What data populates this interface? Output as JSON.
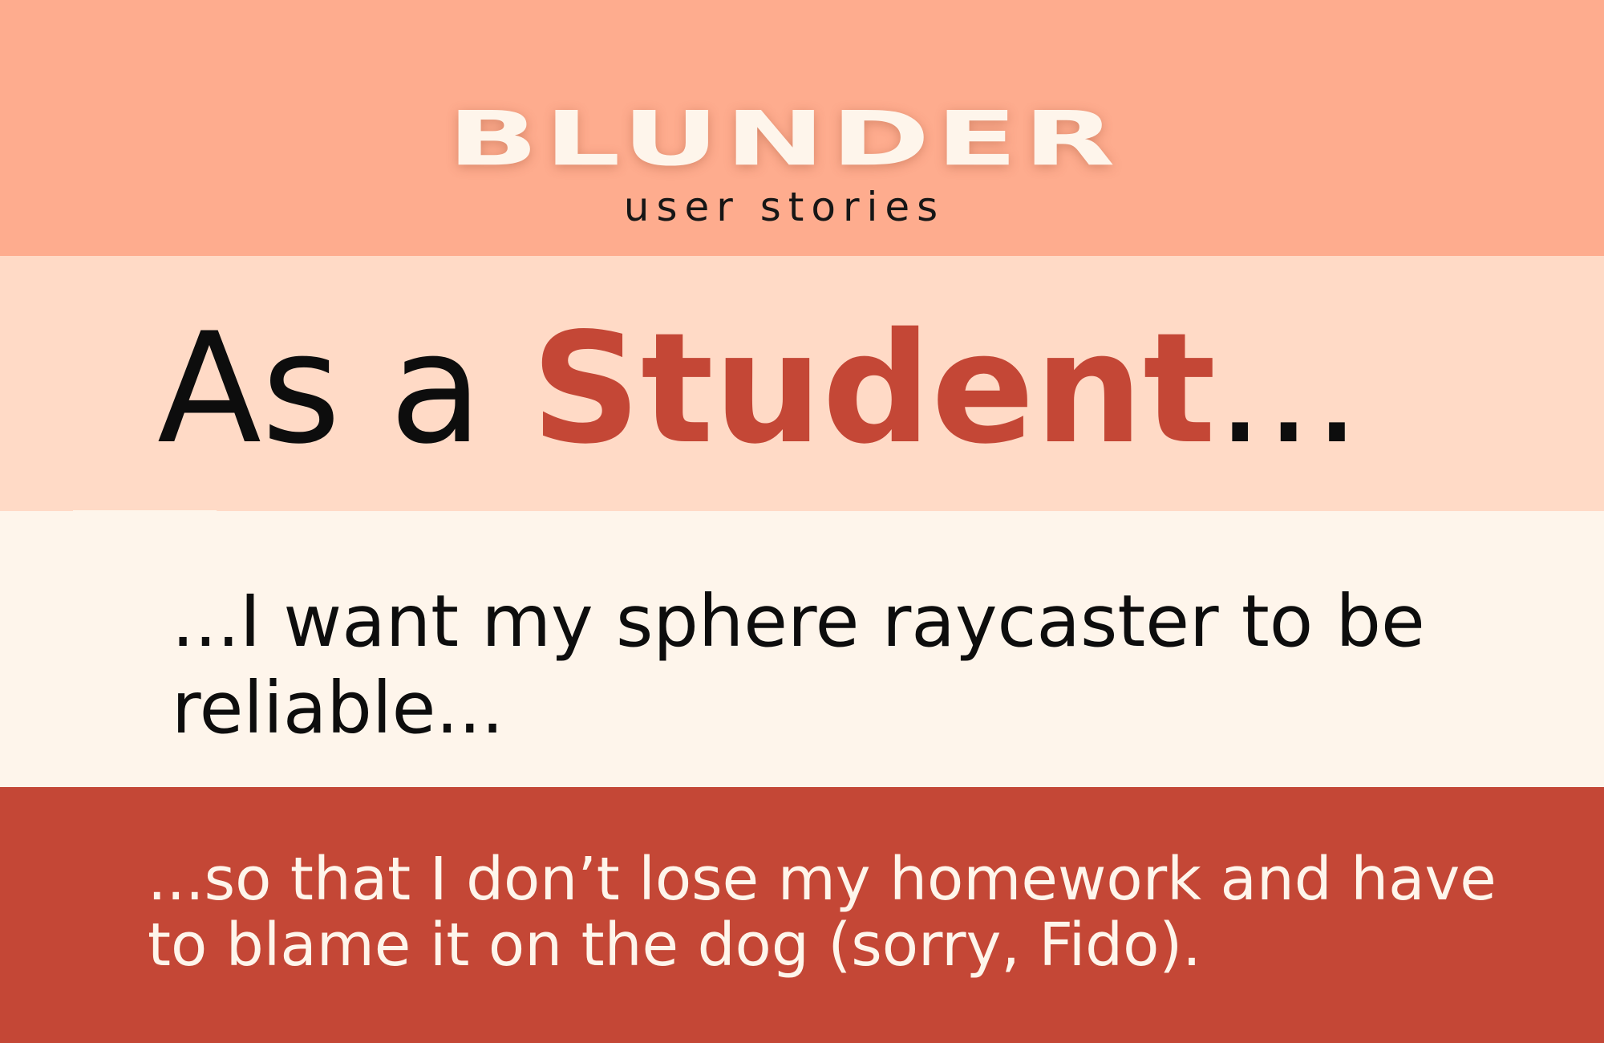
{
  "header": {
    "brand": "BLUNDER",
    "subtitle": "user stories"
  },
  "story": {
    "persona_prefix": "As a ",
    "persona_role": "Student",
    "persona_suffix": "...",
    "want": "...I want my sphere raycaster to be reliable...",
    "reason": "...so that I don’t lose my homework and have to blame it on the dog (sorry, Fido)."
  },
  "colors": {
    "header_band": "#FEAC8E",
    "persona_band": "#FFDAC6",
    "want_band": "#FEF5EB",
    "reason_band": "#C44736",
    "accent": "#C44736",
    "text_dark": "#0D0D0D",
    "text_light": "#FEF5EB"
  }
}
